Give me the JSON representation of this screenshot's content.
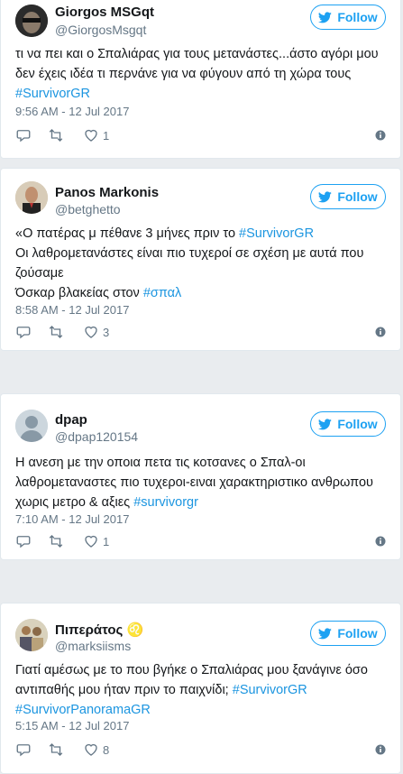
{
  "follow_label": "Follow",
  "accent_color": "#1da1f2",
  "tweets": [
    {
      "name": "Giorgos MSGqt",
      "handle": "@GiorgosMsgqt",
      "text_lines": [
        "τι να πει και ο Σπαλιάρας για τους μετανάστες...άστο αγόρι μου",
        "δεν έχεις ιδέα τι περνάνε για να φύγουν από τη χώρα τους"
      ],
      "hashtag_line": "#SurvivorGR",
      "time": "9:56 AM - 12 Jul 2017",
      "likes": "1"
    },
    {
      "name": "Panos Markonis",
      "handle": "@betghetto",
      "line1_text": "«Ο πατέρας μ πέθανε 3 μήνες πριν το ",
      "line1_tag": "#SurvivorGR",
      "line2": "Οι λαθρομετανάστες είναι πιο τυχεροί σε σχέση με αυτά που",
      "line3": "ζούσαμε",
      "line4_text": "Όσκαρ βλακείας στον ",
      "line4_tag": "#σπαλ",
      "time": "8:58 AM - 12 Jul 2017",
      "likes": "3"
    },
    {
      "name": "dpap",
      "handle": "@dpap120154",
      "line1": "Η ανεση με την οποια πετα τις κοτσανες ο Σπαλ-οι",
      "line2": "λαθρομεταναστες πιο τυχεροι-ειναι χαρακτηριστικο ανθρωπου",
      "line3_text": "χωρις μετρο & αξιες ",
      "line3_tag": "#survivorgr",
      "time": "7:10 AM - 12 Jul 2017",
      "likes": "1"
    },
    {
      "name": "Πιπεράτος ♌",
      "handle": "@marksiisms",
      "line1": "Γιατί αμέσως με το που βγήκε ο Σπαλιάρας μου ξανάγινε όσο",
      "line2_text": "αντιπαθής μου ήταν πριν το παιχνίδι; ",
      "line2_tag": "#SurvivorGR",
      "line3_tag": "#SurvivorPanoramaGR",
      "time": "5:15 AM - 12 Jul 2017",
      "likes": "8"
    }
  ]
}
